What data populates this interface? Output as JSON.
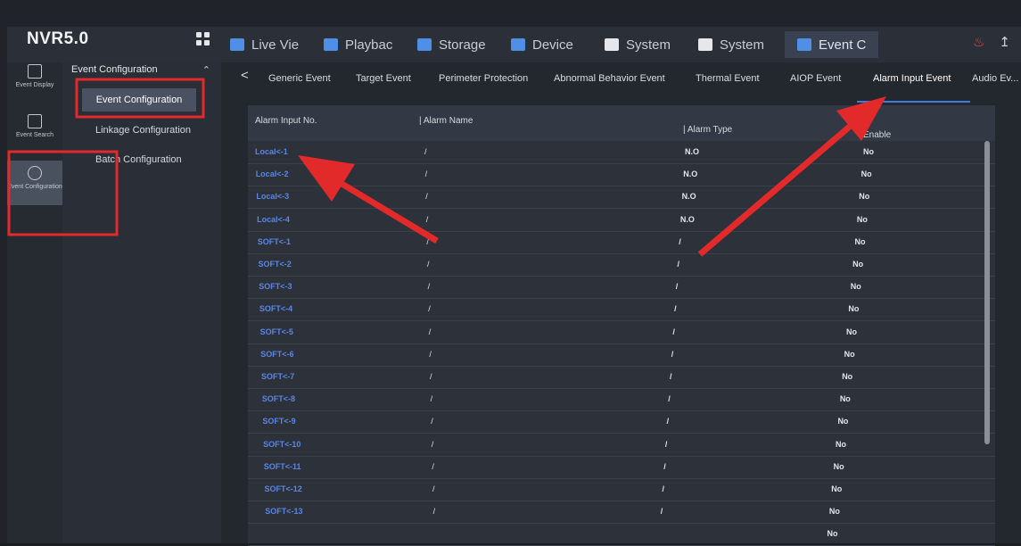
{
  "app": {
    "brand": "NVR5.0"
  },
  "top_tabs": [
    {
      "label": "Live Vie"
    },
    {
      "label": "Playbac"
    },
    {
      "label": "Storage"
    },
    {
      "label": "Device"
    },
    {
      "label": "System"
    },
    {
      "label": "System"
    },
    {
      "label": "Event C"
    }
  ],
  "rail": [
    {
      "label": "Event Display"
    },
    {
      "label": "Event Search"
    },
    {
      "label": "Event Configuration"
    }
  ],
  "submenu": {
    "header": "Event Configuration",
    "items": [
      {
        "label": "Event Configuration"
      },
      {
        "label": "Linkage Configuration"
      },
      {
        "label": "Batch Configuration"
      }
    ]
  },
  "event_tabs": [
    {
      "label": "Generic Event"
    },
    {
      "label": "Target Event"
    },
    {
      "label": "Perimeter Protection"
    },
    {
      "label": "Abnormal Behavior Event"
    },
    {
      "label": "Thermal Event"
    },
    {
      "label": "AIOP Event"
    },
    {
      "label": "Alarm Input Event"
    },
    {
      "label": "Audio Ev..."
    }
  ],
  "table": {
    "headers": [
      "Alarm Input No.",
      "Alarm Name",
      "Alarm Type",
      "Enable"
    ],
    "rows": [
      {
        "no": "Local<-1",
        "name": "/",
        "type": "N.O",
        "enable": "No"
      },
      {
        "no": "Local<-2",
        "name": "/",
        "type": "N.O",
        "enable": "No"
      },
      {
        "no": "Local<-3",
        "name": "/",
        "type": "N.O",
        "enable": "No"
      },
      {
        "no": "Local<-4",
        "name": "/",
        "type": "N.O",
        "enable": "No"
      },
      {
        "no": "SOFT<-1",
        "name": "/",
        "type": "/",
        "enable": "No"
      },
      {
        "no": "SOFT<-2",
        "name": "/",
        "type": "/",
        "enable": "No"
      },
      {
        "no": "SOFT<-3",
        "name": "/",
        "type": "/",
        "enable": "No"
      },
      {
        "no": "SOFT<-4",
        "name": "/",
        "type": "/",
        "enable": "No"
      },
      {
        "no": "SOFT<-5",
        "name": "/",
        "type": "/",
        "enable": "No"
      },
      {
        "no": "SOFT<-6",
        "name": "/",
        "type": "/",
        "enable": "No"
      },
      {
        "no": "SOFT<-7",
        "name": "/",
        "type": "/",
        "enable": "No"
      },
      {
        "no": "SOFT<-8",
        "name": "/",
        "type": "/",
        "enable": "No"
      },
      {
        "no": "SOFT<-9",
        "name": "/",
        "type": "/",
        "enable": "No"
      },
      {
        "no": "SOFT<-10",
        "name": "/",
        "type": "/",
        "enable": "No"
      },
      {
        "no": "SOFT<-11",
        "name": "/",
        "type": "/",
        "enable": "No"
      },
      {
        "no": "SOFT<-12",
        "name": "/",
        "type": "/",
        "enable": "No"
      },
      {
        "no": "SOFT<-13",
        "name": "/",
        "type": "/",
        "enable": "No"
      },
      {
        "no": "",
        "name": "",
        "type": "",
        "enable": "No"
      }
    ]
  },
  "colors": {
    "link_blue": "#5b86e6",
    "annotation_red": "#e22a2a",
    "active_underline": "#3c7be0"
  }
}
